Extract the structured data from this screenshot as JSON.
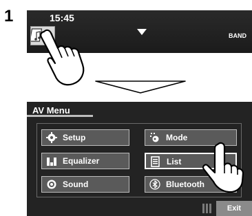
{
  "step_number": "1",
  "top_screen": {
    "clock": "15:45",
    "band_label": "BAND",
    "source_icon": "music-video-source-icon"
  },
  "av_menu": {
    "title": "AV Menu",
    "buttons": [
      {
        "label": "Setup",
        "icon": "gear-icon"
      },
      {
        "label": "Mode",
        "icon": "mode-icon"
      },
      {
        "label": "Equalizer",
        "icon": "equalizer-icon"
      },
      {
        "label": "List",
        "icon": "list-icon"
      },
      {
        "label": "Sound",
        "icon": "sound-icon"
      },
      {
        "label": "Bluetooth",
        "icon": "bluetooth-icon"
      }
    ],
    "exit_label": "Exit"
  }
}
